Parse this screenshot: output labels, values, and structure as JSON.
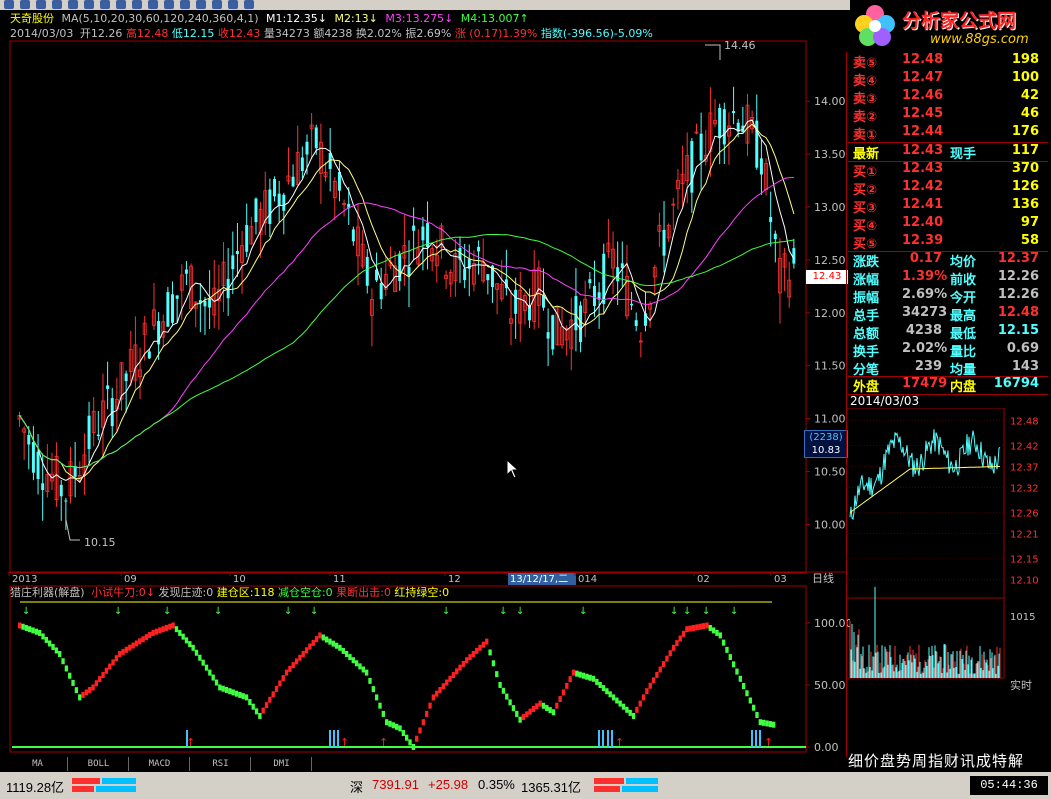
{
  "header": {
    "stock_name": "天奇股份",
    "ma_label": "MA(5,10,20,30,60,120,240,360,4,1)",
    "m1": "M1:12.35",
    "m2": "M2:13",
    "m3": "M3:13.275",
    "m4": "M4:13.007",
    "line2_date": "2014/03/03",
    "open": "开12.26",
    "high": "高12.48",
    "low": "低12.15",
    "close": "收12.43",
    "volume": "量34273",
    "amount": "额4238",
    "turnover": "换2.02%",
    "amplitude": "振2.69%",
    "change": "涨 (0.17)1.39%",
    "index": "指数(-396.56)-5.09%"
  },
  "price_axis": {
    "ticks": [
      "14.00",
      "13.50",
      "13.00",
      "12.50",
      "12.00",
      "11.50",
      "11.00",
      "10.50",
      "10.00"
    ],
    "current_tag": "12.43",
    "cursor_count": "(2238)",
    "cursor_value": "10.83"
  },
  "price_annotations": {
    "high_label": "14.46",
    "low_label": "10.15"
  },
  "date_axis": {
    "labels": [
      "2013",
      "09",
      "10",
      "11",
      "12",
      "13/12/17,二",
      "014",
      "02",
      "03"
    ],
    "period_label": "日线"
  },
  "indicator": {
    "name": "猎庄利器(解盘)",
    "items": [
      {
        "label": "小试牛刀:0",
        "color": "#ff3030"
      },
      {
        "label": "发现庄迹:0",
        "color": "#c0c0c0"
      },
      {
        "label": "建仓区:118",
        "color": "#ffff00"
      },
      {
        "label": "减仓空仓:0",
        "color": "#40ff40"
      },
      {
        "label": "果断出击:0",
        "color": "#ff3030"
      },
      {
        "label": "红持绿空:0",
        "color": "#ffff00"
      }
    ],
    "axis_ticks": [
      "100.00",
      "50.00",
      "0.00"
    ]
  },
  "logo": {
    "title": "分析家公式网",
    "url": "www.88gs.com"
  },
  "quote": {
    "sells": [
      {
        "label": "卖⑤",
        "price": "12.48",
        "vol": "198"
      },
      {
        "label": "卖④",
        "price": "12.47",
        "vol": "100"
      },
      {
        "label": "卖③",
        "price": "12.46",
        "vol": "42"
      },
      {
        "label": "卖②",
        "price": "12.45",
        "vol": "46"
      },
      {
        "label": "卖①",
        "price": "12.44",
        "vol": "176"
      }
    ],
    "latest": {
      "label": "最新",
      "price": "12.43",
      "label2": "现手",
      "vol": "117"
    },
    "buys": [
      {
        "label": "买①",
        "price": "12.43",
        "vol": "370"
      },
      {
        "label": "买②",
        "price": "12.42",
        "vol": "126"
      },
      {
        "label": "买③",
        "price": "12.41",
        "vol": "136"
      },
      {
        "label": "买④",
        "price": "12.40",
        "vol": "97"
      },
      {
        "label": "买⑤",
        "price": "12.39",
        "vol": "58"
      }
    ],
    "stats": [
      {
        "l1": "涨跌",
        "v1": "0.17",
        "l2": "均价",
        "v2": "12.37"
      },
      {
        "l1": "涨幅",
        "v1": "1.39%",
        "l2": "前收",
        "v2": "12.26"
      },
      {
        "l1": "振幅",
        "v1": "2.69%",
        "l2": "今开",
        "v2": "12.26"
      },
      {
        "l1": "总手",
        "v1": "34273",
        "l2": "最高",
        "v2": "12.48"
      },
      {
        "l1": "总额",
        "v1": "4238",
        "l2": "最低",
        "v2": "12.15"
      },
      {
        "l1": "换手",
        "v1": "2.02%",
        "l2": "量比",
        "v2": "0.69"
      },
      {
        "l1": "分笔",
        "v1": "239",
        "l2": "均量",
        "v2": "143"
      },
      {
        "l1": "外盘",
        "v1": "17479",
        "l2": "内盘",
        "v2": "16794"
      }
    ]
  },
  "intraday": {
    "date": "2014/03/03",
    "ticks": [
      "12.48",
      "12.42",
      "12.37",
      "12.32",
      "12.26",
      "12.21",
      "12.15",
      "12.10"
    ],
    "vol_tick": "1015",
    "mode_label": "实时"
  },
  "bottom_tabs": [
    "MA",
    "BOLL",
    "MACD",
    "RSI",
    "DMI"
  ],
  "ticker_text": "细价盘势周指财讯成特解",
  "status": {
    "sh_amount": "1119.28亿",
    "sz_label": "深",
    "sz_index": "7391.91",
    "sz_change": "+25.98",
    "sz_pct": "0.35%",
    "sz_amount": "1365.31亿",
    "time": "05:44:36"
  },
  "colors": {
    "up": "#ff3030",
    "down": "#50ffff",
    "ma1": "#ffffff",
    "ma2": "#ffff80",
    "ma3": "#ff40ff",
    "ma4": "#40ff40"
  }
}
